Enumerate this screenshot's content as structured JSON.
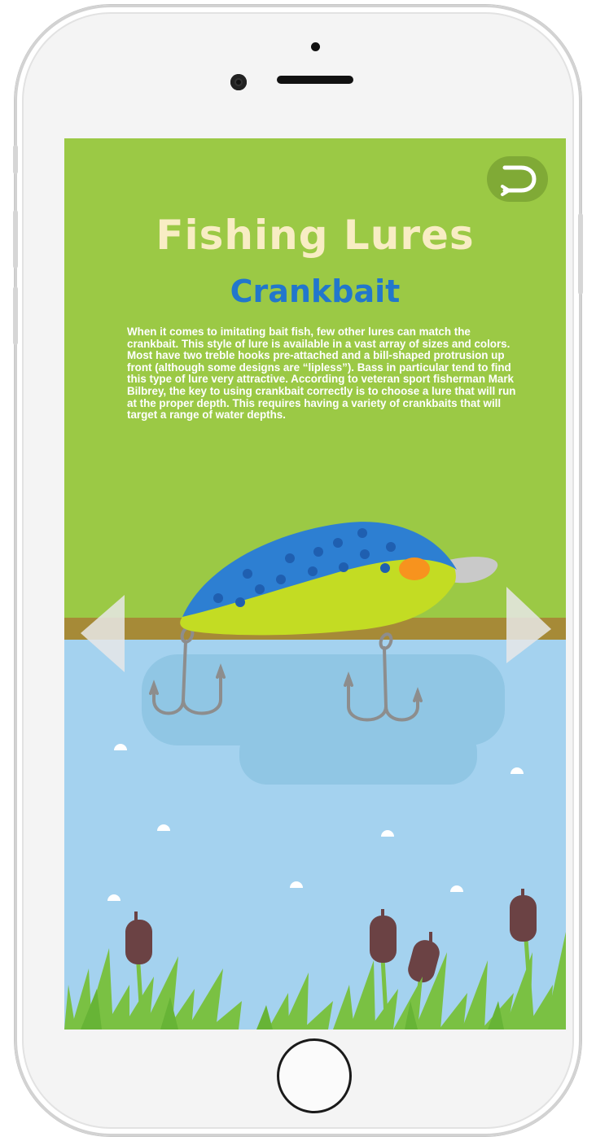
{
  "page": {
    "title": "Fishing Lures",
    "subtitle": "Crankbait",
    "description": "When it comes to imitating bait fish, few other lures can match the crankbait. This style of lure is available in a vast array of sizes and colors. Most have two treble hooks pre-attached and a bill-shaped protrusion up front (although some designs are “lipless”). Bass in particular tend to find this type of lure very attractive. According to veteran sport fisherman Mark Bilbrey, the key to using crankbait correctly is to choose a lure that will run at the proper depth. This requires having a variety of crankbaits that will target a range of water depths."
  },
  "icons": {
    "back": "return-arrow-icon",
    "prev": "triangle-left-icon",
    "next": "triangle-right-icon",
    "lure": "crankbait-lure-illustration",
    "home": "home-button"
  },
  "colors": {
    "background_green": "#9bc945",
    "title_cream": "#f8edc4",
    "subtitle_blue": "#2277cc",
    "water_blue": "#a4d2ef",
    "dirt_brown": "#a68a37",
    "lure_blue": "#2d7fd2",
    "lure_yellow": "#c3dc23",
    "lure_eye_orange": "#f7931e",
    "cattail_brown": "#6b4244",
    "grass_green": "#7ac143"
  }
}
